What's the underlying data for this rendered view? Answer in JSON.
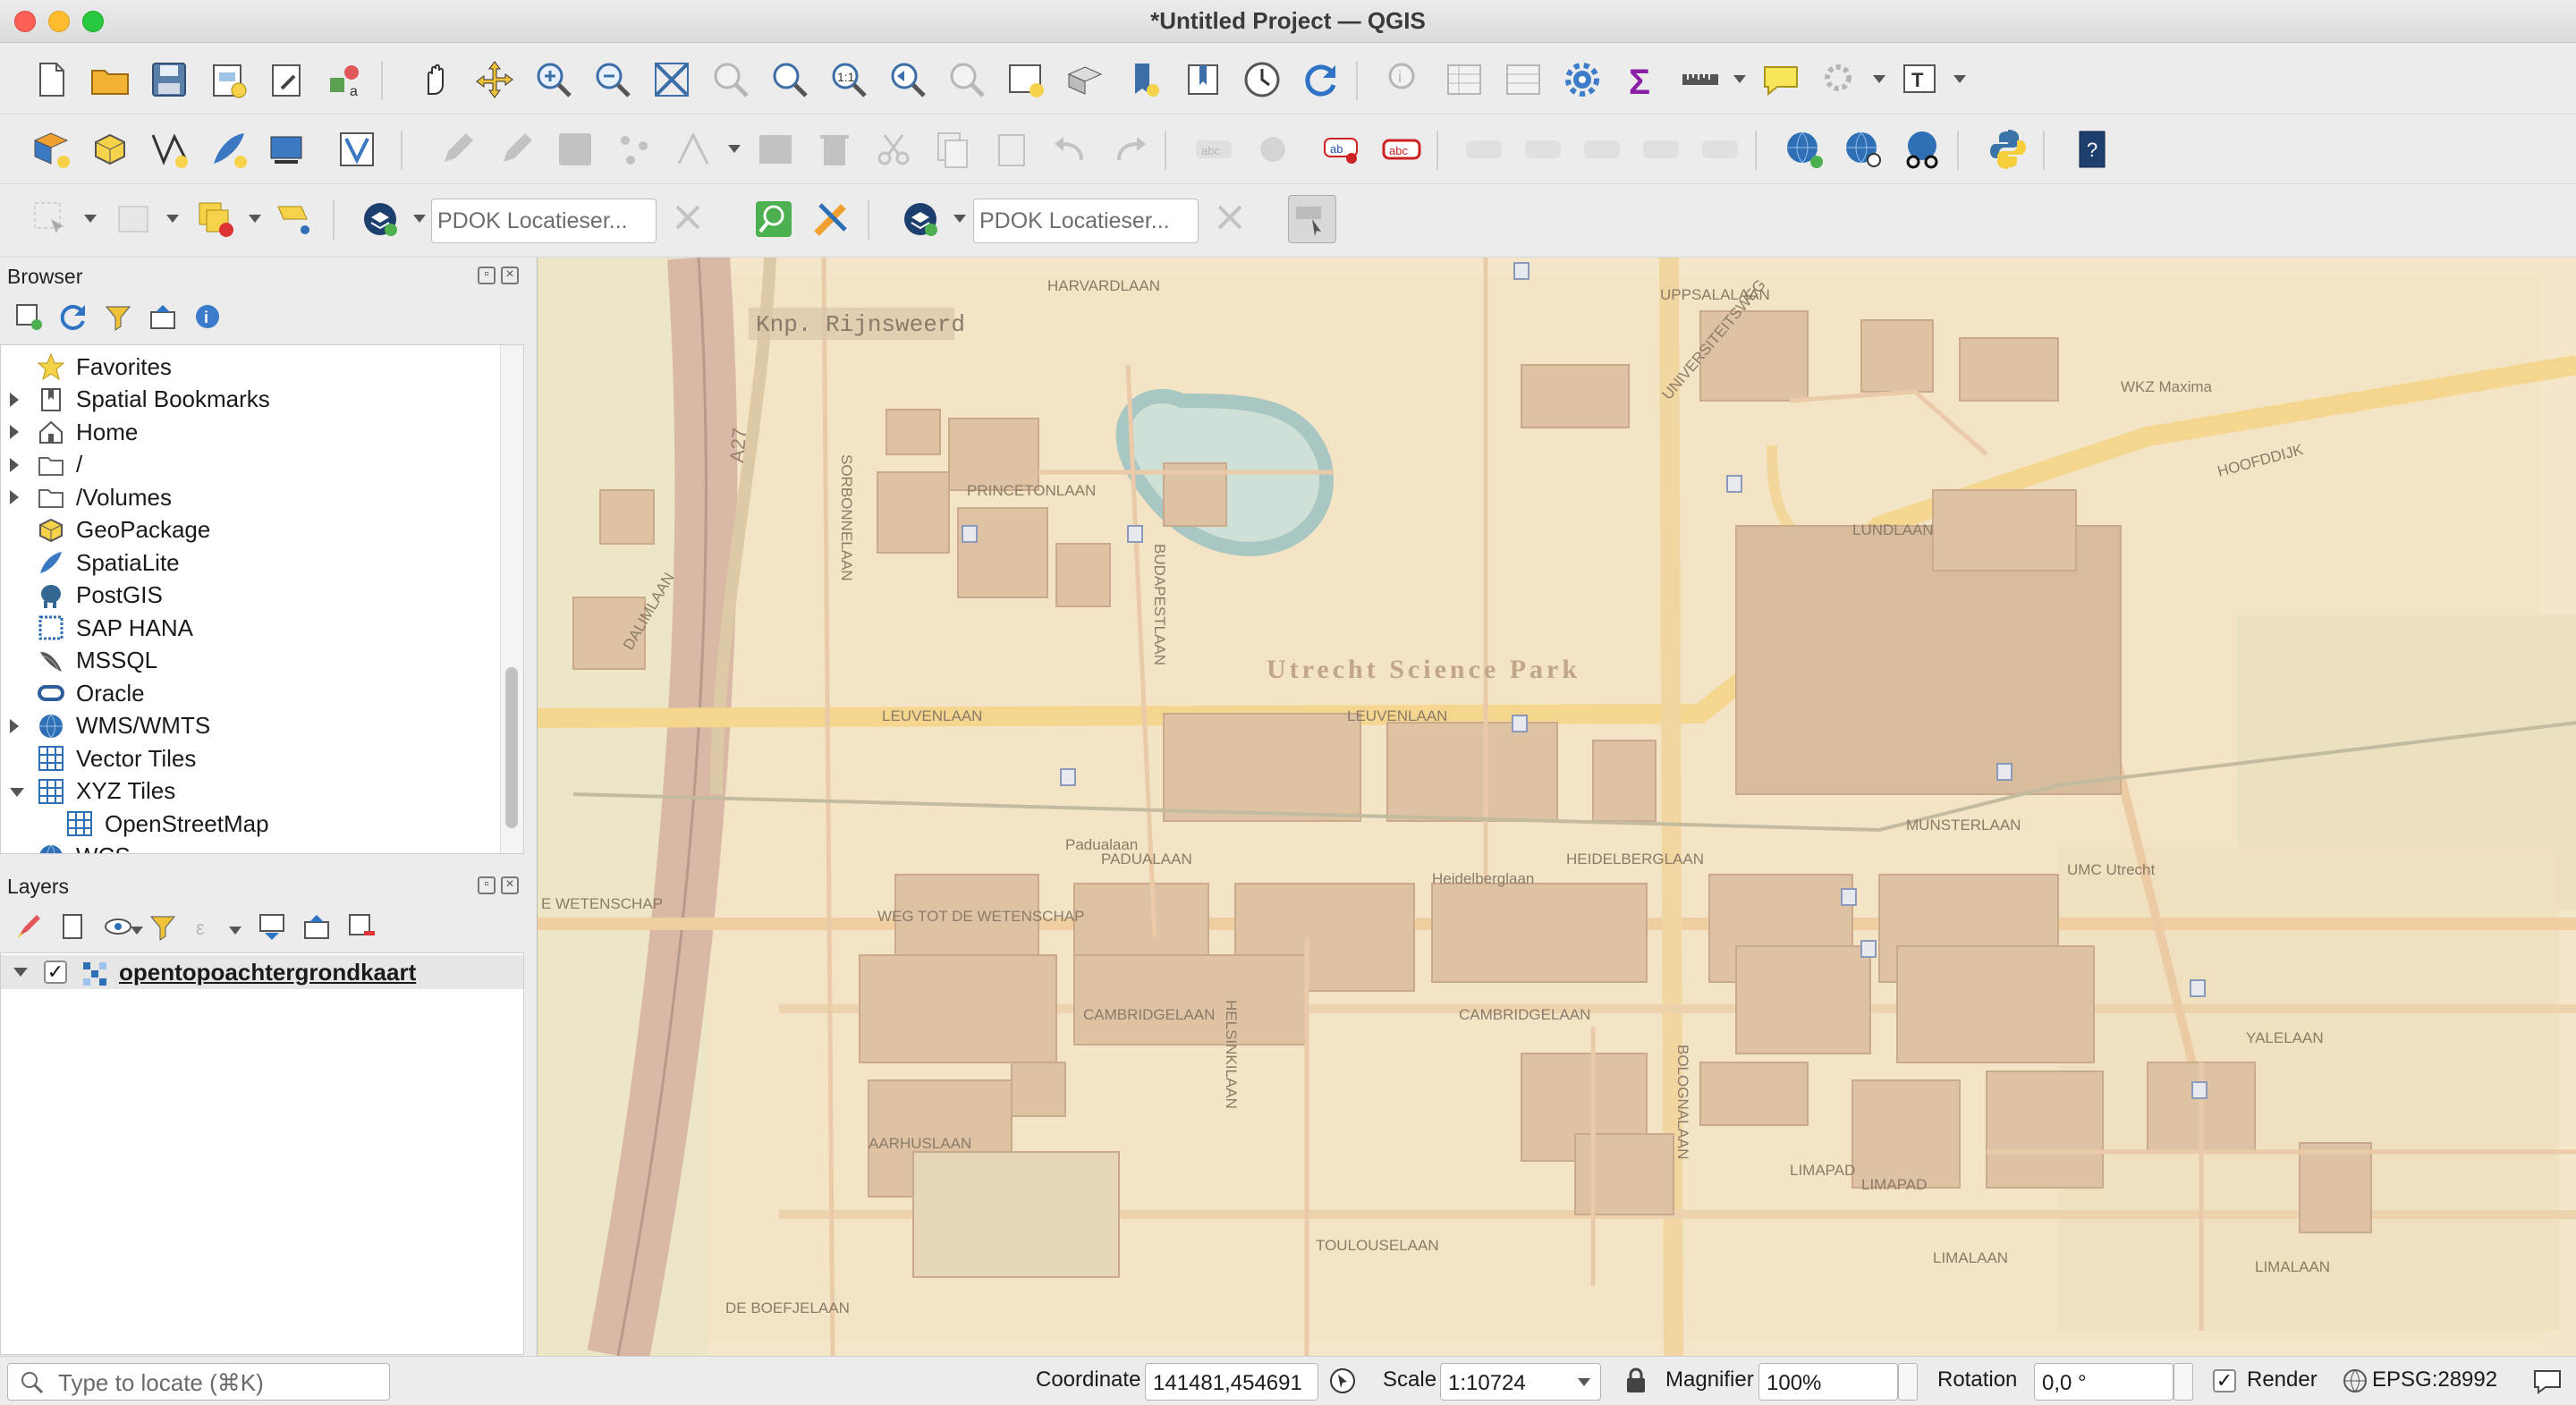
{
  "window": {
    "title": "*Untitled Project — QGIS"
  },
  "toolbars": {
    "pdok_search_1": {
      "placeholder": "PDOK Locatieser..."
    },
    "pdok_search_2": {
      "placeholder": "PDOK Locatieser..."
    }
  },
  "browser": {
    "title": "Browser",
    "items": [
      {
        "label": "Favorites",
        "icon": "star-icon",
        "expand": "none"
      },
      {
        "label": "Spatial Bookmarks",
        "icon": "bookmark-icon",
        "expand": "right"
      },
      {
        "label": "Home",
        "icon": "home-icon",
        "expand": "right"
      },
      {
        "label": "/",
        "icon": "folder-icon",
        "expand": "right"
      },
      {
        "label": "/Volumes",
        "icon": "folder-icon",
        "expand": "right"
      },
      {
        "label": "GeoPackage",
        "icon": "geopackage-icon",
        "expand": "none"
      },
      {
        "label": "SpatiaLite",
        "icon": "spatialite-icon",
        "expand": "none"
      },
      {
        "label": "PostGIS",
        "icon": "elephant-icon",
        "expand": "none"
      },
      {
        "label": "SAP HANA",
        "icon": "hana-icon",
        "expand": "none"
      },
      {
        "label": "MSSQL",
        "icon": "mssql-icon",
        "expand": "none"
      },
      {
        "label": "Oracle",
        "icon": "oracle-icon",
        "expand": "none"
      },
      {
        "label": "WMS/WMTS",
        "icon": "globe-icon",
        "expand": "right"
      },
      {
        "label": "Vector Tiles",
        "icon": "grid-icon",
        "expand": "none"
      },
      {
        "label": "XYZ Tiles",
        "icon": "grid-icon",
        "expand": "down"
      },
      {
        "label": "OpenStreetMap",
        "icon": "grid-icon",
        "expand": "child"
      },
      {
        "label": "WCS",
        "icon": "globe-icon",
        "expand": "none"
      }
    ]
  },
  "layers": {
    "title": "Layers",
    "items": [
      {
        "name": "opentopoachtergrondkaart",
        "checked": true
      }
    ]
  },
  "map": {
    "labels": {
      "knp": "Knp. Rijnsweerd",
      "science_park": "Utrecht Science Park",
      "harvardlaan": "HARVARDLAAN",
      "uppsalalaan": "UPPSALALAAN",
      "princetonlaan": "PRINCETONLAAN",
      "universiteitsweg": "UNIVERSITEITSWEG",
      "lundlaan": "LUNDLAAN",
      "hoofddijk": "HOOFDDIJK",
      "leuvenlaan_w": "LEUVENLAAN",
      "leuvenlaan_e": "LEUVENLAAN",
      "padualaan": "PADUALAAN",
      "heidelberglaan": "HEIDELBERGLAAN",
      "heidelberglaan2": "Heidelberglaan",
      "padualaan2": "Padualaan",
      "cambridgelaan_w": "CAMBRIDGELAAN",
      "cambridgelaan_e": "CAMBRIDGELAAN",
      "aarhuslaan": "AARHUSLAAN",
      "toulouselaan": "TOULOUSELAAN",
      "limalaan": "LIMALAAN",
      "limalaan2": "LIMALAAN",
      "yalelaan": "YALELAAN",
      "munsterlaan": "MUNSTERLAAN",
      "wetenschap": "WEG TOT DE WETENSCHAP",
      "wetenschap2": "E WETENSCHAP",
      "sorbonnelaan": "SORBONNELAAN",
      "budapestlaan": "BUDAPESTLAAN",
      "bolognalaan": "BOLOGNALAAN",
      "a27": "A27",
      "dalimlaan": "DALIMLAAN",
      "wkz": "WKZ\nMaxima",
      "umc": "UMC\nUtrecht",
      "lundlaan2": "LUNDLAAN",
      "helsinkilaan": "HELSINKILAAN",
      "limapad": "LIMAPAD",
      "limapad2": "LIMAPAD",
      "boefjelaan": "DE BOEFJELAAN"
    }
  },
  "status": {
    "locate_placeholder": "Type to locate (⌘K)",
    "coordinate_label": "Coordinate",
    "coordinate_value": "141481,454691",
    "scale_label": "Scale",
    "scale_value": "1:10724",
    "magnifier_label": "Magnifier",
    "magnifier_value": "100%",
    "rotation_label": "Rotation",
    "rotation_value": "0,0 °",
    "render_label": "Render",
    "render_checked": true,
    "crs": "EPSG:28992"
  },
  "colors": {
    "map_base": "#f4e6c8",
    "building": "#dcc2a4",
    "road_major": "#f9d98a",
    "water": "#b9d3cf",
    "green": "#e4e6c0"
  }
}
